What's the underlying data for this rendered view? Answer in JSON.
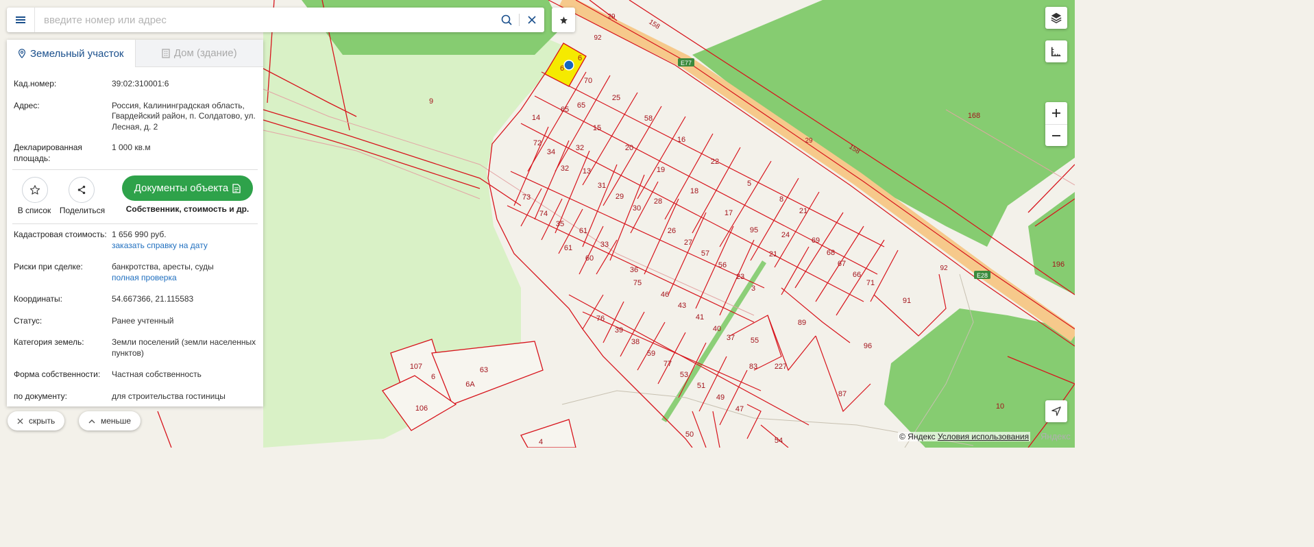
{
  "search": {
    "placeholder": "введите номер или адрес"
  },
  "tabs": [
    {
      "label": "Земельный участок",
      "active": true,
      "icon": "map-pin-icon"
    },
    {
      "label": "Дом (здание)",
      "active": false,
      "icon": "building-icon"
    }
  ],
  "parcel": {
    "cad_label": "Кад.номер:",
    "cad_value": "39:02:310001:6",
    "address_label": "Адрес:",
    "address_value": "Россия, Калининградская область, Гвардейский район, п. Солдатово, ул. Лесная, д. 2",
    "area_label": "Декларированная площадь:",
    "area_value": "1 000 кв.м"
  },
  "actions": {
    "to_list": "В список",
    "share": "Поделиться",
    "docs_button": "Документы объекта",
    "docs_sub": "Собственник, стоимость и др."
  },
  "details": {
    "cost_label": "Кадастровая стоимость:",
    "cost_value": "1 656 990 руб.",
    "cost_link": "заказать справку на дату",
    "risks_label": "Риски при сделке:",
    "risks_value": "банкротства, аресты, суды",
    "risks_link": "полная проверка",
    "coords_label": "Координаты:",
    "coords_value": "54.667366, 21.115583",
    "status_label": "Статус:",
    "status_value": "Ранее учтенный",
    "category_label": "Категория земель:",
    "category_value": "Земли поселений (земли населенных пунктов)",
    "ownership_label": "Форма собственности:",
    "ownership_value": "Частная собственность",
    "purpose_label": "по документу:",
    "purpose_value": "для строительства гостиницы"
  },
  "buttons": {
    "hide": "скрыть",
    "less": "меньше"
  },
  "map": {
    "copyright": "© Яндекс",
    "terms": "Условия использования",
    "logo": "Яндекс",
    "highway_labels": [
      "E77",
      "E28"
    ],
    "road_numbers": [
      "29",
      "158",
      "92",
      "29",
      "158",
      "92"
    ],
    "parcel_numbers": [
      "6",
      "6",
      "70",
      "25",
      "65",
      "65",
      "14",
      "15",
      "58",
      "72",
      "34",
      "32",
      "20",
      "16",
      "22",
      "32",
      "13",
      "19",
      "5",
      "73",
      "31",
      "28",
      "18",
      "8",
      "29",
      "30",
      "17",
      "21",
      "74",
      "35",
      "61",
      "26",
      "95",
      "24",
      "69",
      "61",
      "33",
      "27",
      "57",
      "21",
      "68",
      "67",
      "60",
      "36",
      "56",
      "66",
      "23",
      "75",
      "71",
      "46",
      "43",
      "3",
      "91",
      "41",
      "40",
      "89",
      "37",
      "76",
      "39",
      "55",
      "96",
      "38",
      "59",
      "83",
      "227",
      "77",
      "53",
      "51",
      "87",
      "49",
      "47",
      "50",
      "54",
      "107",
      "6",
      "63",
      "6А",
      "106",
      "4",
      "9",
      "168",
      "196",
      "10"
    ],
    "colors": {
      "parcel_border": "#d7141c",
      "selected_fill": "#f5ea00",
      "selected_marker": "#1565c0",
      "forest": "#7fcb6a",
      "meadow": "#d8f0c4",
      "highway": "#f6c98b",
      "background": "#f3f1ea"
    }
  }
}
